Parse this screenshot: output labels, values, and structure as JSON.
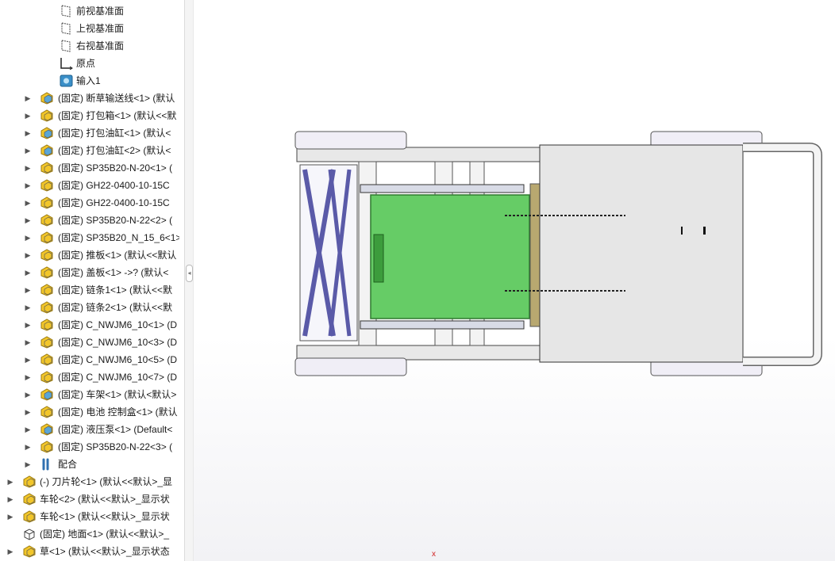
{
  "feature_tree": {
    "items": [
      {
        "label": "前视基准面",
        "icon": "plane-icon",
        "expand": false,
        "level": 3
      },
      {
        "label": "上视基准面",
        "icon": "plane-icon",
        "expand": false,
        "level": 3
      },
      {
        "label": "右视基准面",
        "icon": "plane-icon",
        "expand": false,
        "level": 3
      },
      {
        "label": "原点",
        "icon": "origin-icon",
        "expand": false,
        "level": 3
      },
      {
        "label": "输入1",
        "icon": "imported-body-icon",
        "expand": false,
        "level": 3
      },
      {
        "label": "(固定) 断草输送线<1> (默认",
        "icon": "subassembly-icon",
        "expand": true,
        "level": 2
      },
      {
        "label": "(固定) 打包箱<1> (默认<<默",
        "icon": "part-icon",
        "expand": true,
        "level": 2
      },
      {
        "label": "(固定) 打包油缸<1> (默认<",
        "icon": "subassembly-icon",
        "expand": true,
        "level": 2
      },
      {
        "label": "(固定) 打包油缸<2> (默认<",
        "icon": "subassembly-icon",
        "expand": true,
        "level": 2
      },
      {
        "label": "(固定) SP35B20-N-20<1> (",
        "icon": "part-icon",
        "expand": true,
        "level": 2
      },
      {
        "label": "(固定) GH22-0400-10-15C",
        "icon": "part-icon",
        "expand": true,
        "level": 2
      },
      {
        "label": "(固定) GH22-0400-10-15C",
        "icon": "part-icon",
        "expand": true,
        "level": 2
      },
      {
        "label": "(固定) SP35B20-N-22<2> (",
        "icon": "part-icon",
        "expand": true,
        "level": 2
      },
      {
        "label": "(固定) SP35B20_N_15_6<1>",
        "icon": "part-icon",
        "expand": true,
        "level": 2
      },
      {
        "label": "(固定) 推板<1> (默认<<默认",
        "icon": "part-icon",
        "expand": true,
        "level": 2
      },
      {
        "label": "(固定) 盖板<1> ->? (默认<",
        "icon": "part-icon",
        "expand": true,
        "level": 2
      },
      {
        "label": "(固定) 链条1<1> (默认<<默",
        "icon": "part-icon",
        "expand": true,
        "level": 2
      },
      {
        "label": "(固定) 链条2<1> (默认<<默",
        "icon": "part-icon",
        "expand": true,
        "level": 2
      },
      {
        "label": "(固定) C_NWJM6_10<1> (D",
        "icon": "part-icon",
        "expand": true,
        "level": 2
      },
      {
        "label": "(固定) C_NWJM6_10<3> (D",
        "icon": "part-icon",
        "expand": true,
        "level": 2
      },
      {
        "label": "(固定) C_NWJM6_10<5> (D",
        "icon": "part-icon",
        "expand": true,
        "level": 2
      },
      {
        "label": "(固定) C_NWJM6_10<7> (D",
        "icon": "part-icon",
        "expand": true,
        "level": 2
      },
      {
        "label": "(固定) 车架<1> (默认<默认>",
        "icon": "subassembly-icon",
        "expand": true,
        "level": 2
      },
      {
        "label": "(固定) 电池 控制盒<1> (默认",
        "icon": "part-icon",
        "expand": true,
        "level": 2
      },
      {
        "label": "(固定) 液压泵<1> (Default<",
        "icon": "subassembly-icon",
        "expand": true,
        "level": 2
      },
      {
        "label": "(固定) SP35B20-N-22<3> (",
        "icon": "part-icon",
        "expand": true,
        "level": 2
      },
      {
        "label": "配合",
        "icon": "mates-icon",
        "expand": true,
        "level": 2
      },
      {
        "label": "(-) 刀片轮<1> (默认<<默认>_显",
        "icon": "part-icon",
        "expand": true,
        "level": 1
      },
      {
        "label": "车轮<2> (默认<<默认>_显示状",
        "icon": "part-icon",
        "expand": true,
        "level": 1
      },
      {
        "label": "车轮<1> (默认<<默认>_显示状",
        "icon": "part-icon",
        "expand": true,
        "level": 1
      },
      {
        "label": "(固定) 地面<1> (默认<<默认>_",
        "icon": "ground-part-icon",
        "expand": false,
        "level": 1
      },
      {
        "label": "草<1> (默认<<默认>_显示状态",
        "icon": "part-icon",
        "expand": true,
        "level": 1
      }
    ]
  },
  "colors": {
    "part_yellow": "#f2c62a",
    "subassembly_blue": "#5aa6d6",
    "green_box": "#66cc66",
    "chain_purple": "#5a5aa8",
    "frame_gray": "#e6e6e6"
  },
  "viewport": {
    "triad_label": "x"
  }
}
